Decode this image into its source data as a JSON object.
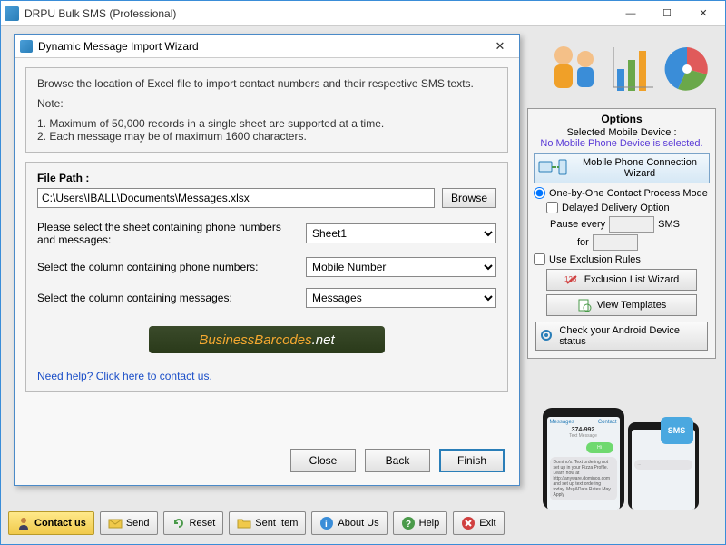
{
  "main": {
    "title": "DRPU Bulk SMS (Professional)"
  },
  "dialog": {
    "title": "Dynamic Message Import Wizard",
    "intro": "Browse the location of Excel file to import contact numbers and their respective SMS texts.",
    "note_heading": "Note:",
    "note1": "1. Maximum of 50,000 records in a single sheet are supported at a time.",
    "note2": "2. Each message may be of maximum 1600 characters.",
    "file_path_label": "File Path :",
    "file_path_value": "C:\\Users\\IBALL\\Documents\\Messages.xlsx",
    "browse": "Browse",
    "select_sheet_label": "Please select the sheet containing phone numbers and messages:",
    "select_sheet_value": "Sheet1",
    "select_phone_col_label": "Select the column containing phone numbers:",
    "select_phone_col_value": "Mobile Number",
    "select_msg_col_label": "Select the column containing messages:",
    "select_msg_col_value": "Messages",
    "help_link": "Need help? Click here to contact us.",
    "close": "Close",
    "back": "Back",
    "finish": "Finish"
  },
  "watermark": {
    "part1": "BusinessBarcodes",
    "part2": ".net"
  },
  "options": {
    "title": "Options",
    "selected_device_label": "Selected Mobile Device :",
    "no_device": "No Mobile Phone Device is selected.",
    "conn_wizard": "Mobile Phone Connection  Wizard",
    "one_by_one": "One-by-One Contact Process Mode",
    "delayed": "Delayed Delivery Option",
    "pause_every": "Pause every",
    "sms": "SMS",
    "for": "for",
    "use_exclusion": "Use Exclusion Rules",
    "exclusion_wizard": "Exclusion List Wizard",
    "view_templates": "View Templates",
    "check_android": "Check your Android Device status"
  },
  "phone": {
    "back": "Messages",
    "number": "374-992",
    "contact": "Contact",
    "sub": "Text Message",
    "bubble1": "Hi",
    "bubble2": "Domino's: Text ordering not set up in your Pizza Profile. Learn how at http://anyware.dominos.com and set up text ordering today. Msg&Data Rates May Apply",
    "sms_badge": "SMS"
  },
  "toolbar": {
    "contact_us": "Contact us",
    "send": "Send",
    "reset": "Reset",
    "sent_item": "Sent Item",
    "about": "About Us",
    "help": "Help",
    "exit": "Exit"
  }
}
